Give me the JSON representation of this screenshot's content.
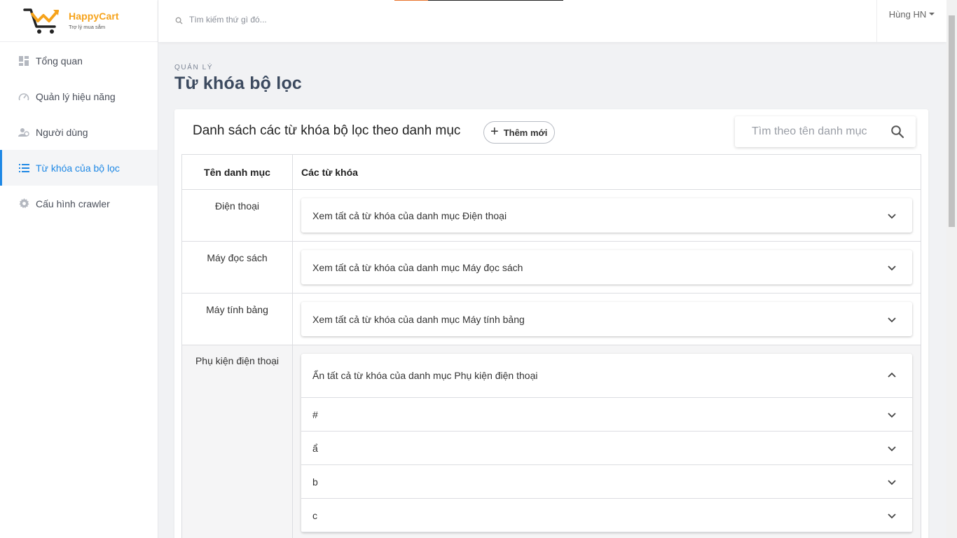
{
  "brand": {
    "name": "HappyCart",
    "tagline": "Trợ lý mua sắm"
  },
  "sidebar": {
    "items": [
      {
        "label": "Tổng quan",
        "icon": "dashboard-icon",
        "active": false
      },
      {
        "label": "Quản lý hiệu năng",
        "icon": "speedometer-icon",
        "active": false
      },
      {
        "label": "Người dùng",
        "icon": "users-icon",
        "active": false
      },
      {
        "label": "Từ khóa của bộ lọc",
        "icon": "list-icon",
        "active": true
      },
      {
        "label": "Cấu hình crawler",
        "icon": "gear-icon",
        "active": false
      }
    ]
  },
  "topbar": {
    "search_placeholder": "Tìm kiếm thứ gì đó...",
    "user_name": "Hùng HN"
  },
  "header": {
    "eyebrow": "QUẢN LÝ",
    "title": "Từ khóa bộ lọc"
  },
  "card": {
    "title": "Danh sách các từ khóa bộ lọc theo danh mục",
    "add_label": "Thêm mới",
    "search_placeholder": "Tìm theo tên danh mục"
  },
  "table": {
    "headers": [
      "Tên danh mục",
      "Các từ khóa"
    ],
    "rows": [
      {
        "category": "Điện thoại",
        "summary": "Xem tất cả từ khóa của danh mục Điện thoại",
        "expanded": false
      },
      {
        "category": "Máy đọc sách",
        "summary": "Xem tất cả từ khóa của danh mục Máy đọc sách",
        "expanded": false
      },
      {
        "category": "Máy tính bảng",
        "summary": "Xem tất cả từ khóa của danh mục Máy tính bảng",
        "expanded": false
      },
      {
        "category": "Phụ kiện điện thoại",
        "summary": "Ẩn tất cả từ khóa của danh mục Phụ kiện điện thoại",
        "expanded": true,
        "keywords": [
          "#",
          "ẩ",
          "b",
          "c"
        ]
      }
    ]
  },
  "colors": {
    "accent": "#1e88e5",
    "brand": "#f6a31b"
  }
}
